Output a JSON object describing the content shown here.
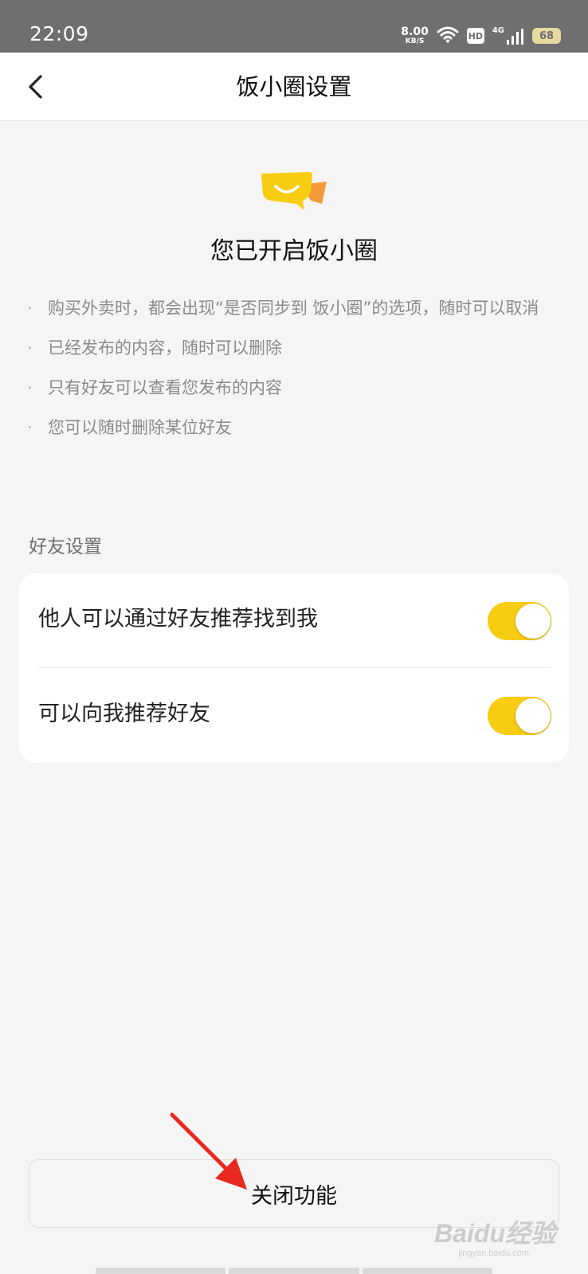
{
  "status_bar": {
    "time": "22:09",
    "net_speed_value": "8.00",
    "net_speed_unit": "KB/S",
    "hd_label": "HD",
    "network_label": "4G",
    "battery_level": "68"
  },
  "nav": {
    "title": "饭小圈设置"
  },
  "hero": {
    "title": "您已开启饭小圈"
  },
  "bullets": [
    "购买外卖时，都会出现“是否同步到 饭小圈”的选项，随时可以取消",
    "已经发布的内容，随时可以删除",
    "只有好友可以查看您发布的内容",
    "您可以随时删除某位好友"
  ],
  "bullet_marker": "·",
  "friend_settings": {
    "section_label": "好友设置",
    "items": [
      {
        "label": "他人可以通过好友推荐找到我",
        "enabled": true
      },
      {
        "label": "可以向我推荐好友",
        "enabled": true
      }
    ]
  },
  "actions": {
    "close_label": "关闭功能"
  },
  "watermark": {
    "brand": "Baidu经验",
    "url": "jingyan.baidu.com"
  },
  "colors": {
    "accent": "#f8cc10",
    "status_bar": "#6f6f6f",
    "background": "#f5f5f5",
    "annotation_arrow": "#e8291f"
  }
}
